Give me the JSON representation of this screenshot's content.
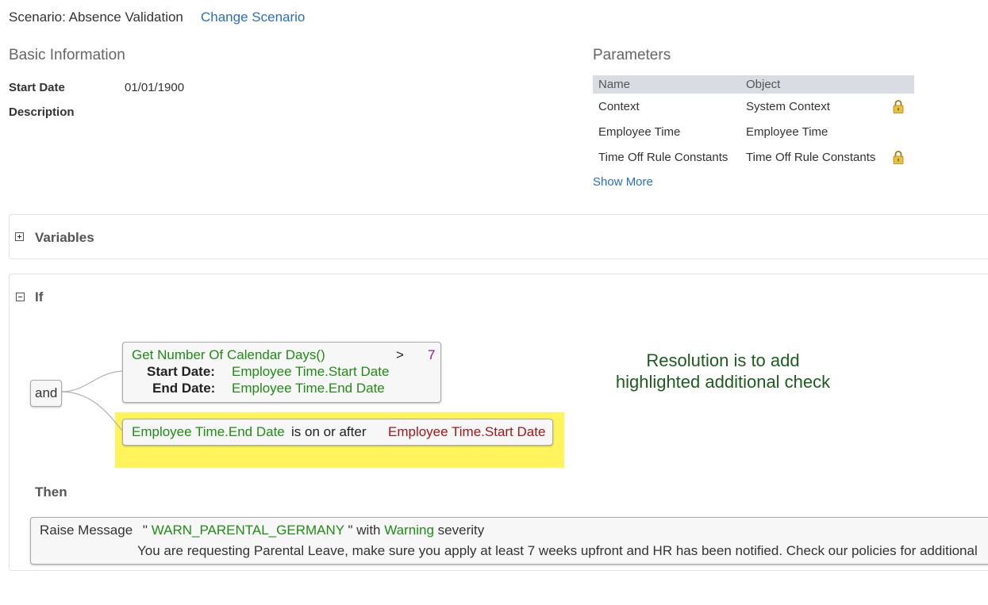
{
  "header": {
    "scenario": "Scenario: Absence Validation",
    "change_scenario": "Change Scenario"
  },
  "basic_info": {
    "title": "Basic Information",
    "start_date_label": "Start Date",
    "start_date_value": "01/01/1900",
    "description_label": "Description"
  },
  "parameters": {
    "title": "Parameters",
    "columns": [
      "Name",
      "Object"
    ],
    "rows": [
      {
        "name": "Context",
        "object": "System Context",
        "locked": true
      },
      {
        "name": "Employee Time",
        "object": "Employee Time",
        "locked": false
      },
      {
        "name": "Time Off Rule Constants",
        "object": "Time Off Rule Constants",
        "locked": true
      }
    ],
    "show_more": "Show More"
  },
  "variables": {
    "title": "Variables"
  },
  "if_block": {
    "title": "If",
    "operator": "and",
    "condition1": {
      "function": "Get Number Of Calendar Days()",
      "comparator": ">",
      "value": "7",
      "start_label": "Start Date:",
      "start_value": "Employee Time.Start Date",
      "end_label": "End Date:",
      "end_value": "Employee Time.End Date"
    },
    "condition2": {
      "left": "Employee Time.End Date",
      "op": "is on or after",
      "right": "Employee Time.Start Date"
    }
  },
  "note": {
    "line1": "Resolution is to add",
    "line2": "highlighted additional check"
  },
  "then_block": {
    "title": "Then",
    "action": "Raise Message",
    "quote_open": "\"",
    "message_code": "WARN_PARENTAL_GERMANY",
    "quote_close": "\" with",
    "severity": "Warning",
    "severity_suffix": "severity",
    "message_text": "You are requesting Parental Leave, make sure you apply at least 7 weeks upfront and HR has been notified. Check our policies for additional"
  },
  "colors": {
    "link": "#2a6fbd",
    "expression_green": "#1f8c14",
    "expression_red": "#a3161c",
    "highlight": "#fff45c",
    "note_green": "#1c5c1c"
  }
}
